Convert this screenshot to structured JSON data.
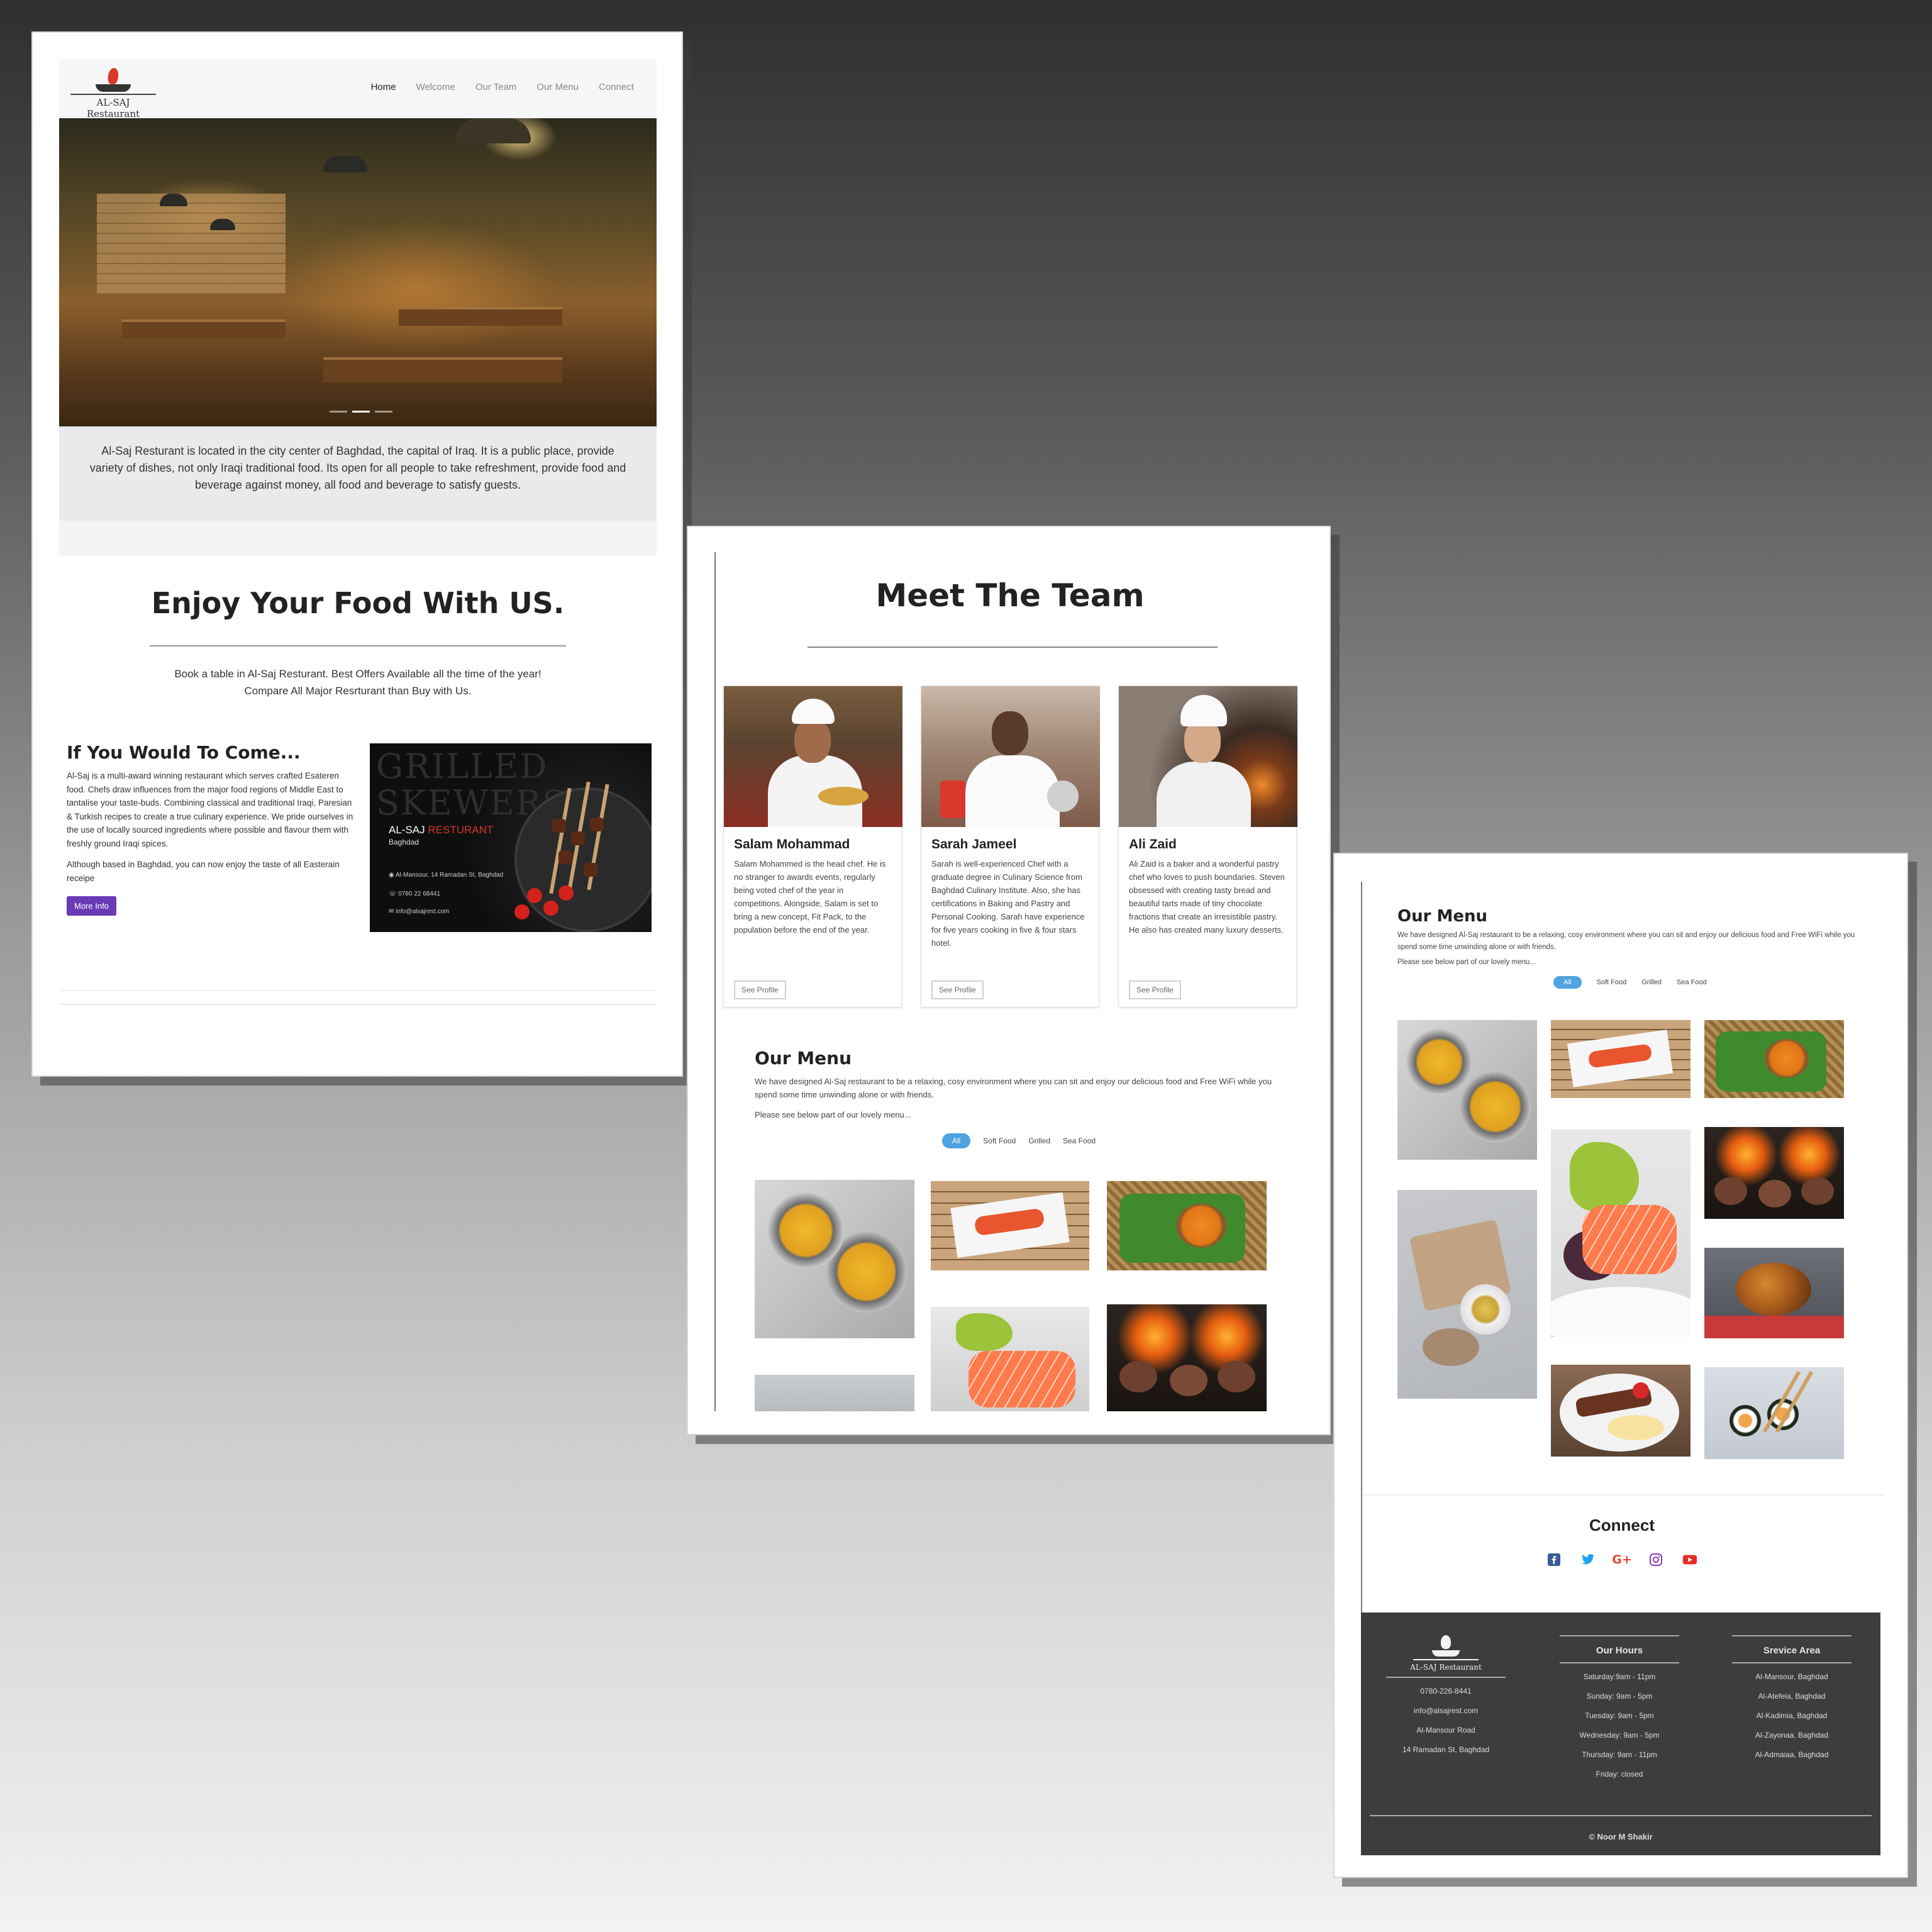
{
  "brand": {
    "logo_text": "AL-SAJ Restaurant"
  },
  "nav": {
    "items": [
      {
        "label": "Home",
        "active": true
      },
      {
        "label": "Welcome"
      },
      {
        "label": "Our Team"
      },
      {
        "label": "Our Menu"
      },
      {
        "label": "Connect"
      }
    ]
  },
  "intro": {
    "text": "Al-Saj Resturant is located in the city center of Baghdad, the capital of Iraq. It is a public place, provide variety of dishes, not only Iraqi traditional food. Its open for all people to take refreshment, provide food and beverage against money, all food and beverage to satisfy guests."
  },
  "enjoy": {
    "title": "Enjoy Your Food With US.",
    "text": "Book a table in Al-Saj Resturant. Best Offers Available all the time of the year! Compare All Major Resrturant than Buy with Us."
  },
  "come": {
    "title": "If You Would To Come...",
    "p1": "Al-Saj is a multi-award winning restaurant which serves crafted Esateren food. Chefs draw influences from the major food regions of Middle East to tantalise your taste-buds. Combining classical and traditional Iraqi, Paresian & Turkish recipes to create a true culinary experience. We pride ourselves in the use of locally sourced ingredients where possible and flavour them with freshly ground Iraqi spices.",
    "p2": "Although based in Baghdad, you can now enjoy the taste of all Easterain receipe",
    "button": "More Info"
  },
  "promo": {
    "big_text": "GRILLED SKEWERS",
    "brand_a": "AL-SAJ",
    "brand_b": "RESTURANT",
    "city": "Baghdad",
    "address": "Al-Mansour, 14 Ramadan St, Baghdad",
    "phone": "0780 22 68441",
    "email": "info@alsajrest.com"
  },
  "team": {
    "title": "Meet The Team",
    "members": [
      {
        "name": "Salam Mohammad",
        "bio": "Salam Mohammed is the head chef. He is no stranger to awards events, regularly being voted chef of the year in competitions. Alongside, Salam is set to bring a new concept, Fit Pack, to the population before the end of the year.",
        "button": "See Profile"
      },
      {
        "name": "Sarah Jameel",
        "bio": "Sarah is well-experienced Chef with a graduate degree in Culinary Science from Baghdad Culinary Institute. Also, she has certifications in Baking and Pastry and Personal Cooking. Sarah have experience for five years cooking in five & four stars hotel.",
        "button": "See Profile"
      },
      {
        "name": "Ali Zaid",
        "bio": "Ali Zaid is a baker and a wonderful pastry chef who loves to push boundaries. Steven obsessed with creating tasty bread and beautiful tarts made of tiny chocolate fractions that create an irresistible pastry. He also has created many luxury desserts.",
        "button": "See Profile"
      }
    ]
  },
  "menu": {
    "title": "Our Menu",
    "desc": "We have designed Al-Saj restaurant to be a relaxing, cosy environment where you can sit and enjoy our delicious food and Free WiFi while you spend some time unwinding alone or with friends.",
    "sub": "Please see below part of our lovely menu...",
    "filters": [
      "All",
      "Soft Food",
      "Grilled",
      "Sea Food"
    ]
  },
  "connect": {
    "title": "Connect",
    "icons": [
      "facebook-icon",
      "twitter-icon",
      "google-plus-icon",
      "instagram-icon",
      "youtube-icon"
    ]
  },
  "footer": {
    "logo_text": "AL-SAJ Restaurant",
    "contact": [
      "0780-226-8441",
      "info@alsajrest.com",
      "Al-Mansour Road",
      "14 Ramadan St, Baghdad"
    ],
    "hours_title": "Our Hours",
    "hours": [
      "Saturday:9am - 11pm",
      "Sunday: 9am - 5pm",
      "Tuesday: 9am - 5pm",
      "Wednesday: 9am - 5pm",
      "Thursday: 9am - 11pm",
      "Friday: closed"
    ],
    "area_title": "Srevice Area",
    "areas": [
      "Al-Mansour, Baghdad",
      "Al-Atefeia, Baghdad",
      "Al-Kadimia, Baghdad",
      "Al-Zayonaa, Baghdad",
      "Al-Admaiaa, Baghdad"
    ],
    "copyright": "© Noor M Shakir"
  },
  "colors": {
    "accent_purple": "#6a3bb5",
    "filter_blue": "#4ea3e0",
    "footer_bg": "#3d3d3d",
    "promo_red": "#d8352a"
  }
}
